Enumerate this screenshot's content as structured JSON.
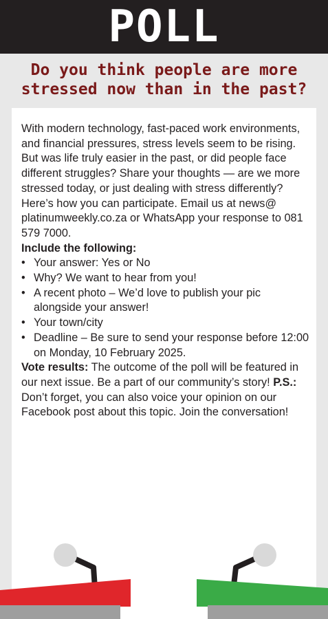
{
  "header": {
    "title": "POLL"
  },
  "question": {
    "line1": "Do you think people are more",
    "line2": "stressed now than in the past?"
  },
  "body": {
    "intro": "With modern technology, fast-paced work environments, and financial pressures, stress levels seem to be rising. But was life truly easier in the past, or did people face different struggles? Share your thoughts — are we more stressed today, or just dealing with stress differently?",
    "participate": "Here’s how you can participate. Email us at news@ platinumweekly.co.za or WhatsApp your response to 081 579 7000.",
    "include_heading": "Include the following:",
    "bullets": [
      "Your answer: Yes or No",
      "Why? We want to hear from you!",
      "A recent photo – We’d love to publish your pic alongside your answer!",
      "Your town/city",
      "Deadline – Be sure to send your response before 12:00 on Monday, 10 February 2025."
    ],
    "bullet_char": "•",
    "vote_label": "Vote results:",
    "vote_text": " The outcome of the poll will be featured in our next issue. Be a part of our community’s story! ",
    "ps_label": "P.S.:",
    "ps_text": " Don’t forget, you can also voice your opinion on our Facebook post about this topic. Join the conversation!"
  },
  "colors": {
    "header_bg": "#231f20",
    "question_text": "#7a1a1a",
    "podium_left": "#e0262b",
    "podium_right": "#3aab47",
    "mic_head": "#d9d9d9",
    "floor": "#9e9e9e"
  }
}
